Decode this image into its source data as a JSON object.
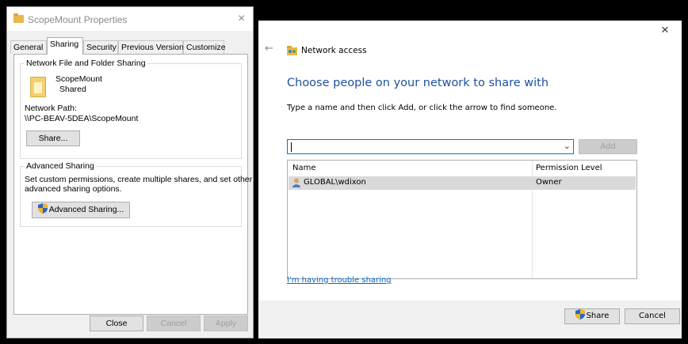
{
  "properties_dialog": {
    "title": "ScopeMount Properties",
    "close_glyph": "×",
    "tabs": [
      {
        "label": "General"
      },
      {
        "label": "Sharing"
      },
      {
        "label": "Security"
      },
      {
        "label": "Previous Versions"
      },
      {
        "label": "Customize"
      }
    ],
    "network_sharing": {
      "legend": "Network File and Folder Sharing",
      "folder_name": "ScopeMount",
      "folder_status": "Shared",
      "path_label": "Network Path:",
      "path_value": "\\\\PC-BEAV-5DEA\\ScopeMount",
      "share_button": "Share..."
    },
    "advanced_sharing": {
      "legend": "Advanced Sharing",
      "description_line1": "Set custom permissions, create multiple shares, and set other",
      "description_line2": "advanced sharing options.",
      "button": "Advanced Sharing..."
    },
    "buttons": {
      "close": "Close",
      "cancel": "Cancel",
      "apply": "Apply"
    }
  },
  "network_access": {
    "close_glyph": "×",
    "back_glyph": "←",
    "title": "Network access",
    "heading": "Choose people on your network to share with",
    "instruction": "Type a name and then click Add, or click the arrow to find someone.",
    "input_value": "",
    "add_button": "Add",
    "columns": {
      "name": "Name",
      "permission": "Permission Level"
    },
    "rows": [
      {
        "name": "GLOBAL\\wdixon",
        "permission": "Owner"
      }
    ],
    "trouble_link": "I'm having trouble sharing",
    "share_button": "Share",
    "cancel_button": "Cancel",
    "colors": {
      "heading": "#1e4f9c",
      "link": "#0066cc",
      "focus_border": "#0078d7"
    }
  }
}
